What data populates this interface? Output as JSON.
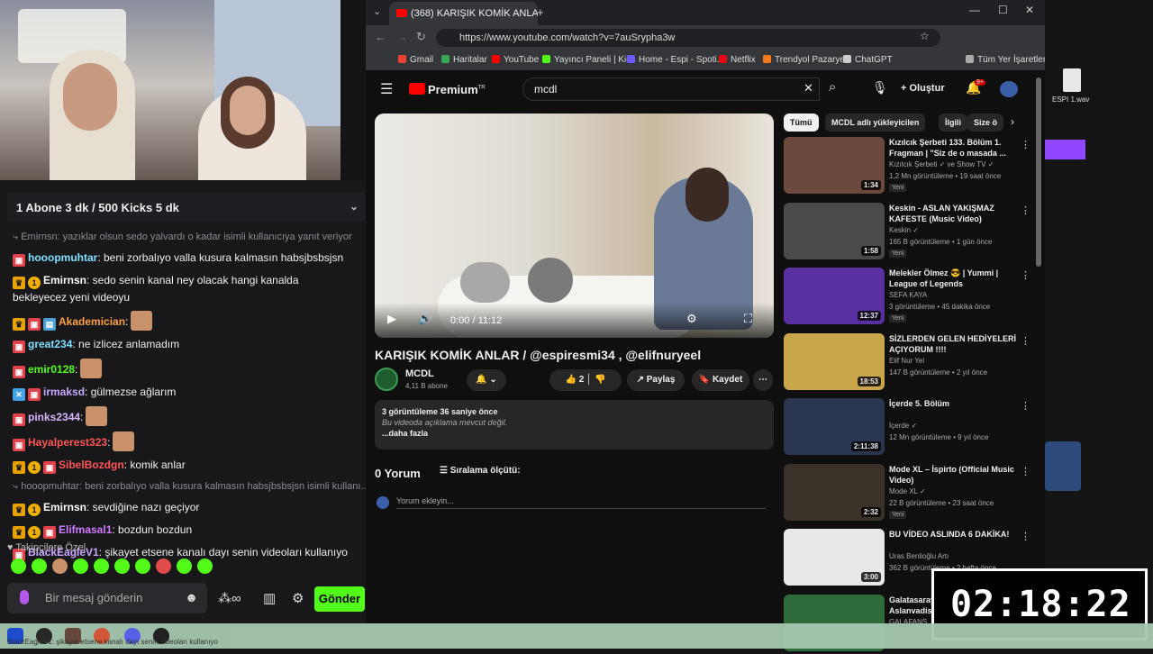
{
  "chat": {
    "pinned": "1 Abone 3 dk / 500 Kicks 5 dk",
    "messages": [
      {
        "type": "reply",
        "text": "⤷ Emirnsn: yazıklar olsun sedo yalvardı o kadar isimli kullanıcıya yanıt veriyor"
      },
      {
        "user": "hooopmuhtar",
        "color": "#7de0ff",
        "text": ": beni zorbalıyo valla kusura kalmasın habsjbsbsjsn",
        "badges": [
          "sub"
        ]
      },
      {
        "user": "Emirnsn",
        "color": "#ffffff",
        "text": ": sedo senin kanal ney olacak hangi kanalda bekleyecez yeni videoyu",
        "badges": [
          "crown",
          "one"
        ]
      },
      {
        "user": "Akademician",
        "color": "#ff9f40",
        "text": ":",
        "badges": [
          "crown",
          "sub",
          "gift"
        ],
        "emote": true
      },
      {
        "user": "great234",
        "color": "#7de0ff",
        "text": ": ne izlicez anlamadım",
        "badges": [
          "sub"
        ]
      },
      {
        "user": "emir0128",
        "color": "#53fc18",
        "text": ":",
        "badges": [
          "sub"
        ],
        "emote": true
      },
      {
        "user": "irmaksd",
        "color": "#c9a7ff",
        "text": ": gülmezse ağlarım",
        "badges": [
          "x",
          "sub"
        ]
      },
      {
        "user": "pinks2344",
        "color": "#d8b4ff",
        "text": ":",
        "badges": [
          "sub"
        ],
        "emote": true
      },
      {
        "user": "Hayalperest323",
        "color": "#ff5555",
        "text": ":",
        "badges": [
          "sub"
        ],
        "emote": true
      },
      {
        "user": "SibelBozdgn",
        "color": "#ff5555",
        "text": ": komik anlar",
        "badges": [
          "crown",
          "one",
          "sub"
        ]
      },
      {
        "type": "reply",
        "text": "⤷ hooopmuhtar: beni zorbalıyo valla kusura kalmasın habsjbsbsjsn isimli kullanı..."
      },
      {
        "user": "Emirnsn",
        "color": "#ffffff",
        "text": ": sevdiğine nazı geçiyor",
        "badges": [
          "crown",
          "one"
        ]
      },
      {
        "user": "Elifmasal1",
        "color": "#d07bff",
        "text": ": bozdun bozdun",
        "badges": [
          "crown",
          "one",
          "sub"
        ]
      },
      {
        "user": "BlackEagleV1",
        "color": "#c9a7ff",
        "text": ": şikayet etsene kanalı dayı senin videoları kullanıyo",
        "badges": [
          "sub"
        ]
      }
    ],
    "follow_label": "Takipçilere Özel",
    "input_placeholder": "Bir mesaj gönderin",
    "send_label": "Gönder"
  },
  "browser": {
    "tab_title": "(368) KARIŞIK KOMİK ANLAR",
    "url": "https://www.youtube.com/watch?v=7auSrypha3w",
    "bookmarks": [
      "Gmail",
      "Haritalar",
      "YouTube",
      "Yayıncı Paneli | Kick",
      "Home - Espi - Spoti...",
      "Netflix",
      "Trendyol Pazaryeri",
      "ChatGPT",
      "Tüm Yer İşaretleri"
    ]
  },
  "youtube": {
    "logo": "Premium",
    "logo_sup": "TR",
    "search": "mcdl",
    "create": "Oluştur",
    "notif_count": "9+",
    "video_time": "0:00 / 11:12",
    "title": "KARIŞIK KOMİK ANLAR / @espiresmi34 , @elifnuryeel",
    "channel": "MCDL",
    "subs": "4,11 B abone",
    "likes": "2",
    "share": "Paylaş",
    "save": "Kaydet",
    "desc_stats": "3 görüntüleme  36 saniye önce",
    "desc_text": "Bu videoda açıklama mevcut değil.",
    "desc_more": "...daha fazla",
    "comments": "0 Yorum",
    "sort": "Sıralama ölçütü:",
    "comment_ph": "Yorum ekleyin...",
    "chips": [
      "Tümü",
      "MCDL adlı yükleyicilen",
      "İlgili",
      "Size ö"
    ],
    "recs": [
      {
        "title": "Kızılcık Şerbeti 133. Bölüm 1. Fragman | \"Siz de o masada ...",
        "channel": "Kızılcık Şerbeti ✓ ve Show TV ✓",
        "meta": "1,2 Mn görüntüleme • 19 saat önce",
        "new": "Yeni",
        "dur": "1:34",
        "color": "#6b4a3d"
      },
      {
        "title": "Keskin - ASLAN YAKIŞMAZ KAFESTE (Music Video)",
        "channel": "Keskin ✓",
        "meta": "165 B görüntüleme • 1 gün önce",
        "new": "Yeni",
        "dur": "1:58",
        "color": "#4a4a4a"
      },
      {
        "title": "Melekler Ölmez 😎 | Yummi | League of Legends",
        "channel": "SEFA KAYA",
        "meta": "3 görüntüleme • 45 dakika önce",
        "new": "Yeni",
        "dur": "12:37",
        "color": "#5a2fa0"
      },
      {
        "title": "SİZLERDEN GELEN HEDİYELERİ AÇIYORUM !!!!",
        "channel": "Elif Nur Yel",
        "meta": "147 B görüntüleme • 2 yıl önce",
        "new": "",
        "dur": "18:53",
        "color": "#c9a64a"
      },
      {
        "title": "İçerde 5. Bölüm",
        "channel": "İçerde ✓",
        "meta": "12 Mn görüntüleme • 9 yıl önce",
        "new": "",
        "dur": "2:11:38",
        "color": "#2a3550"
      },
      {
        "title": "Mode XL – İspirto (Official Music Video)",
        "channel": "Mode XL ✓",
        "meta": "22 B görüntüleme • 23 saat önce",
        "new": "Yeni",
        "dur": "2:32",
        "color": "#3a3228"
      },
      {
        "title": "BU VİDEO ASLINDA 6 DAKİKA!",
        "channel": "Uras Benlioğlu Artı",
        "meta": "362 B görüntüleme • 2 hafta önce",
        "new": "",
        "dur": "3:00",
        "color": "#e8e8e8"
      },
      {
        "title": "Galatasaray Tramspark stadı Aslanvadisi...",
        "channel": "GALAFANS",
        "meta": "",
        "new": "",
        "dur": "",
        "color": "#2f6a3a"
      }
    ]
  },
  "desktop": {
    "wav_label": "ESPI 1.wav"
  },
  "timer": "02:18:22",
  "taskbar_ticker": "BlackEagleV1: şikayet etsene kanalı dayı senin videoları kullanıyo"
}
